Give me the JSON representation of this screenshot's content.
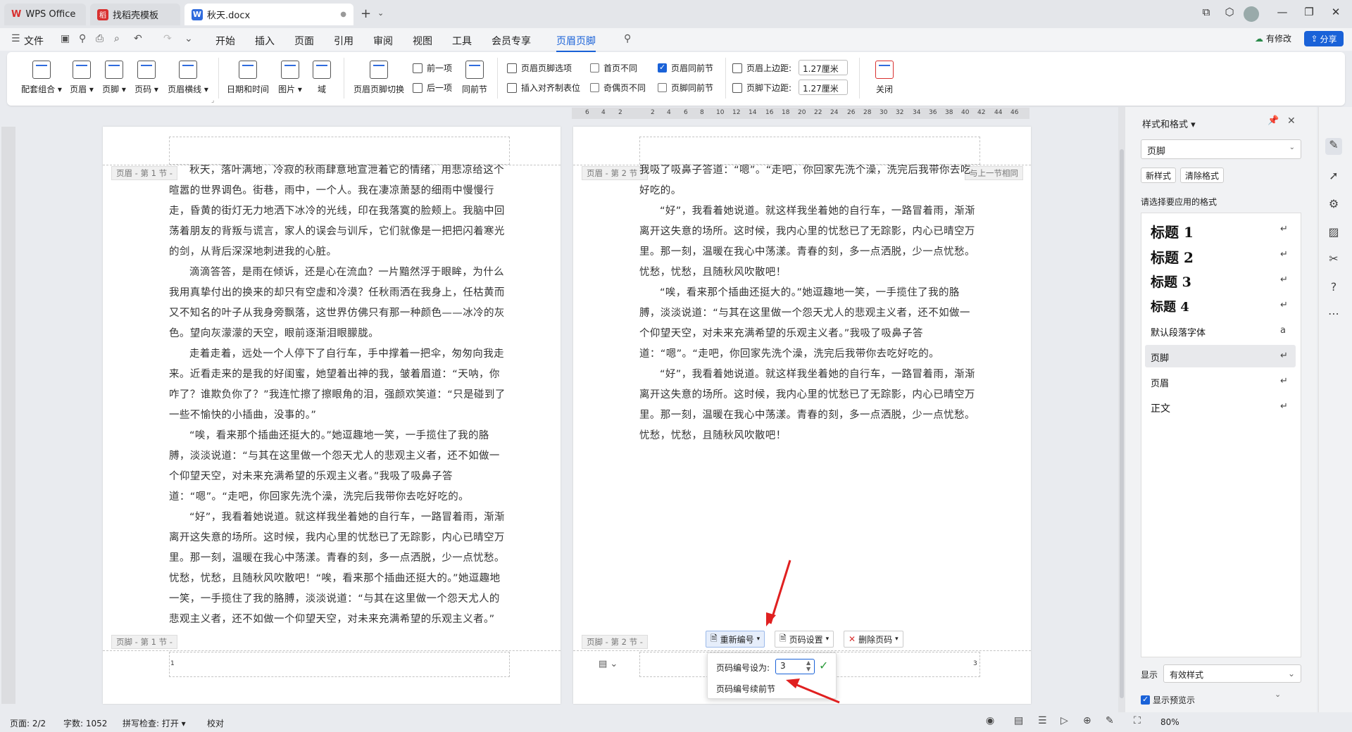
{
  "tabs": [
    {
      "label": "WPS Office"
    },
    {
      "label": "找稻壳模板"
    },
    {
      "label": "秋天.docx"
    }
  ],
  "menu": {
    "file": "文件",
    "items": [
      "开始",
      "插入",
      "页面",
      "引用",
      "审阅",
      "视图",
      "工具",
      "会员专享",
      "页眉页脚"
    ],
    "active": "页眉页脚",
    "modify": "有修改",
    "share": "分享"
  },
  "ribbon": {
    "big": [
      {
        "label": "配套组合 ▾"
      },
      {
        "label": "页眉 ▾"
      },
      {
        "label": "页脚 ▾"
      },
      {
        "label": "页码 ▾"
      },
      {
        "label": "页眉横线 ▾"
      },
      {
        "label": "日期和时间"
      },
      {
        "label": "图片 ▾"
      },
      {
        "label": "域"
      },
      {
        "label": "页眉页脚切换"
      },
      {
        "label": "同前节"
      },
      {
        "label": "关闭"
      }
    ],
    "small": {
      "prev": "前一项",
      "next": "后一项",
      "options": "页眉页脚选项",
      "align_tab": "插入对齐制表位"
    },
    "checks": {
      "first_diff": "首页不同",
      "odd_even": "奇偶页不同",
      "header_same": "页眉同前节",
      "footer_same": "页脚同前节"
    },
    "margins": {
      "top_label": "页眉上边距:",
      "top_value": "1.27厘米",
      "bottom_label": "页脚下边距:",
      "bottom_value": "1.27厘米"
    }
  },
  "ruler": {
    "ticks": [
      "6",
      "4",
      "2",
      "",
      "2",
      "4",
      "6",
      "8",
      "10",
      "12",
      "14",
      "16",
      "18",
      "20",
      "22",
      "24",
      "26",
      "28",
      "30",
      "32",
      "34",
      "36",
      "38",
      "40",
      "42",
      "44",
      "46"
    ]
  },
  "page1": {
    "header_label": "页眉 - 第 1 节 -",
    "footer_label": "页脚 - 第 1 节 -",
    "page_number": "1",
    "paragraphs": [
      "秋天，落叶满地，冷寂的秋雨肆意地宣泄着它的情绪，用悲凉给这个暄嚣的世界调色。街巷，雨中，一个人。我在凄凉萧瑟的细雨中慢慢行走，昏黄的街灯无力地洒下冰冷的光线，印在我落寞的脸颊上。我脑中回荡着朋友的背叛与谎言，家人的误会与训斥，它们就像是一把把闪着寒光的剑，从背后深深地刺进我的心脏。",
      "滴滴答答，是雨在倾诉，还是心在流血？一片黯然浮于眼眸，为什么我用真挚付出的换来的却只有空虚和冷漠？任秋雨洒在我身上，任枯黄而又不知名的叶子从我身旁飘落，这世界仿佛只有那一种颜色——冰冷的灰色。望向灰濛濛的天空，眼前逐渐泪眼朦胧。",
      "走着走着，远处一个人停下了自行车，手中撑着一把伞，匆匆向我走来。近看走来的是我的好闺蜜，她望着出神的我，皱着眉道：“天呐，你咋了？谁欺负你了？”我连忙擦了擦眼角的泪，强颜欢笑道：“只是碰到了一些不愉快的小插曲，没事的。”",
      "“唉，看来那个插曲还挺大的。”她逗趣地一笑，一手揽住了我的胳膊，淡淡说道：“与其在这里做一个怨天尤人的悲观主义者，还不如做一个仰望天空，对未来充满希望的乐观主义者。”我吸了吸鼻子答道：“嗯”。“走吧，你回家先洗个澡，洗完后我带你去吃好吃的。",
      "“好”，我看着她说道。就这样我坐着她的自行车，一路冒着雨，渐渐离开这失意的场所。这时候，我内心里的忧愁已了无踪影，内心已晴空万里。那一刻，温暖在我心中荡漾。青春的刻，多一点洒脱，少一点忧愁。忧愁，忧愁，且随秋风吹散吧！“唉，看来那个插曲还挺大的。”她逗趣地一笑，一手揽住了我的胳膊，淡淡说道：“与其在这里做一个怨天尤人的悲观主义者，还不如做一个仰望天空，对未来充满希望的乐观主义者。”"
    ]
  },
  "page2": {
    "header_label": "页眉 - 第 2 节 -",
    "same_as_prev": "与上一节相同",
    "footer_label": "页脚 - 第 2 节 -",
    "page_number": "3",
    "first_line": "我吸了吸鼻子答道：“嗯”。“走吧，你回家先洗个澡，洗完后我带你去吃好吃的。",
    "paragraphs": [
      "“好”，我看着她说道。就这样我坐着她的自行车，一路冒着雨，渐渐离开这失意的场所。这时候，我内心里的忧愁已了无踪影，内心已晴空万里。那一刻，温暖在我心中荡漾。青春的刻，多一点洒脱，少一点忧愁。忧愁，忧愁，且随秋风吹散吧！",
      "“唉，看来那个插曲还挺大的。”她逗趣地一笑，一手揽住了我的胳膊，淡淡说道：“与其在这里做一个怨天尤人的悲观主义者，还不如做一个仰望天空，对未来充满希望的乐观主义者。”我吸了吸鼻子答道：“嗯”。“走吧，你回家先洗个澡，洗完后我带你去吃好吃的。",
      "“好”，我看着她说道。就这样我坐着她的自行车，一路冒着雨，渐渐离开这失意的场所。这时候，我内心里的忧愁已了无踪影，内心已晴空万里。那一刻，温暖在我心中荡漾。青春的刻，多一点洒脱，少一点忧愁。忧愁，忧愁，且随秋风吹散吧！"
    ]
  },
  "footer_toolbar": {
    "renumber": "重新编号",
    "page_setup": "页码设置",
    "delete": "删除页码"
  },
  "popup": {
    "set_label": "页码编号设为:",
    "value": "3",
    "continue": "页码编号续前节"
  },
  "panel": {
    "title": "样式和格式 ▾",
    "current": "页脚",
    "new_style": "新样式",
    "clear": "清除格式",
    "choose": "请选择要应用的格式",
    "styles": [
      "标题 1",
      "标题 2",
      "标题 3",
      "标题 4",
      "默认段落字体",
      "页脚",
      "页眉",
      "正文"
    ],
    "show_label": "显示",
    "show_value": "有效样式",
    "preview": "显示预览示"
  },
  "status": {
    "page": "页面: 2/2",
    "words": "字数: 1052",
    "spell": "拼写检查: 打开 ▾",
    "proof": "校对",
    "zoom": "80%"
  },
  "colors": {
    "accent": "#1a62d8",
    "wps_red": "#d8302f"
  }
}
